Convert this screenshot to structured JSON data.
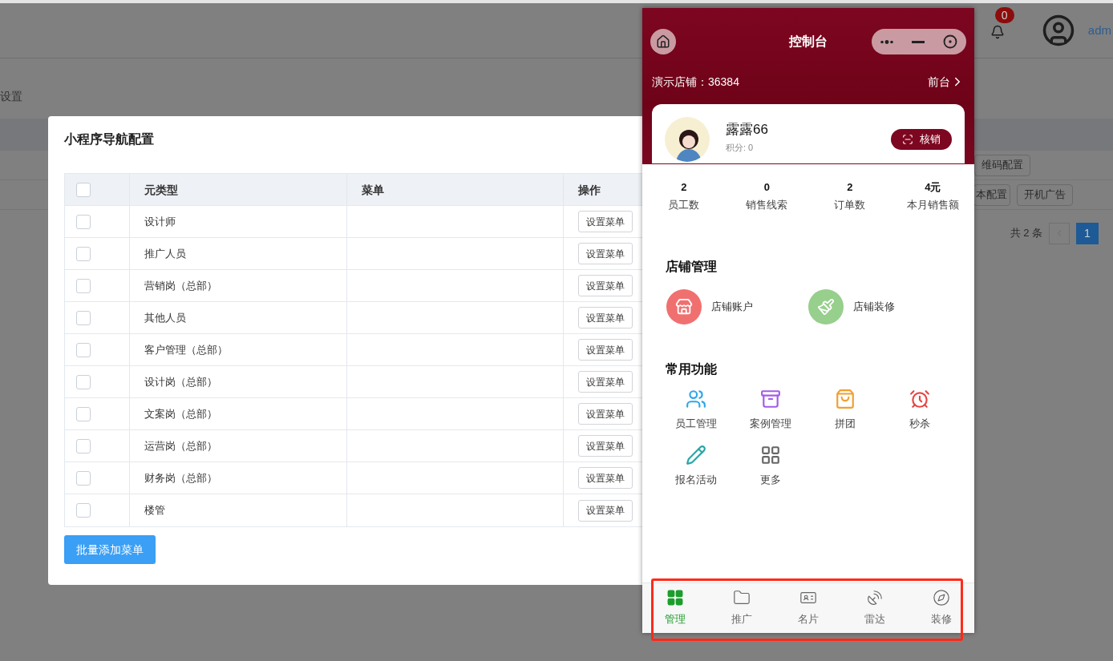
{
  "background": {
    "breadcrumb": "设置",
    "notification_count": "0",
    "user_name": "adm",
    "toolbar_rows": [
      [
        "维码配置"
      ],
      [
        "本配置",
        "开机广告"
      ]
    ],
    "total": "共 2 条",
    "pages": [
      {
        "label": "1",
        "selected": true
      }
    ]
  },
  "modal": {
    "title": "小程序导航配置",
    "columns": [
      "元类型",
      "菜单",
      "操作"
    ],
    "header_checked": false,
    "rows": [
      {
        "type": "设计师",
        "checked": false,
        "action": "设置菜单"
      },
      {
        "type": "推广人员",
        "checked": false,
        "action": "设置菜单"
      },
      {
        "type": "营销岗（总部）",
        "checked": false,
        "action": "设置菜单"
      },
      {
        "type": "其他人员",
        "checked": false,
        "action": "设置菜单"
      },
      {
        "type": "客户管理（总部）",
        "checked": false,
        "action": "设置菜单"
      },
      {
        "type": "设计岗（总部）",
        "checked": false,
        "action": "设置菜单"
      },
      {
        "type": "文案岗（总部）",
        "checked": false,
        "action": "设置菜单"
      },
      {
        "type": "运营岗（总部）",
        "checked": false,
        "action": "设置菜单"
      },
      {
        "type": "财务岗（总部）",
        "checked": false,
        "action": "设置菜单"
      },
      {
        "type": "楼管",
        "checked": false,
        "action": "设置菜单"
      }
    ],
    "batch_button": "批量添加菜单"
  },
  "phone": {
    "title": "控制台",
    "store": "演示店铺：36384",
    "front_link": "前台",
    "user": {
      "name": "露露66",
      "points": "积分: 0",
      "verify_button": "核销"
    },
    "stats": [
      {
        "value": "2",
        "label": "员工数"
      },
      {
        "value": "0",
        "label": "销售线索"
      },
      {
        "value": "2",
        "label": "订单数"
      },
      {
        "value": "4元",
        "label": "本月销售额"
      }
    ],
    "sections": [
      {
        "title": "店铺管理",
        "kind": "large",
        "items": [
          {
            "label": "店铺账户",
            "color": "#f07070"
          },
          {
            "label": "店铺装修",
            "color": "#97cf8c"
          }
        ]
      },
      {
        "title": "常用功能",
        "kind": "grid",
        "items": [
          {
            "label": "员工管理",
            "color": "#2ea7e8"
          },
          {
            "label": "案例管理",
            "color": "#a25ce8"
          },
          {
            "label": "拼团",
            "color": "#f0a030"
          },
          {
            "label": "秒杀",
            "color": "#e84545"
          },
          {
            "label": "报名活动",
            "color": "#2aa6a6"
          },
          {
            "label": "更多",
            "color": "#666666"
          }
        ]
      }
    ],
    "tabs": [
      {
        "label": "管理",
        "selected": true
      },
      {
        "label": "推广",
        "selected": false
      },
      {
        "label": "名片",
        "selected": false
      },
      {
        "label": "雷达",
        "selected": false
      },
      {
        "label": "装修",
        "selected": false
      }
    ],
    "highlight": true
  }
}
